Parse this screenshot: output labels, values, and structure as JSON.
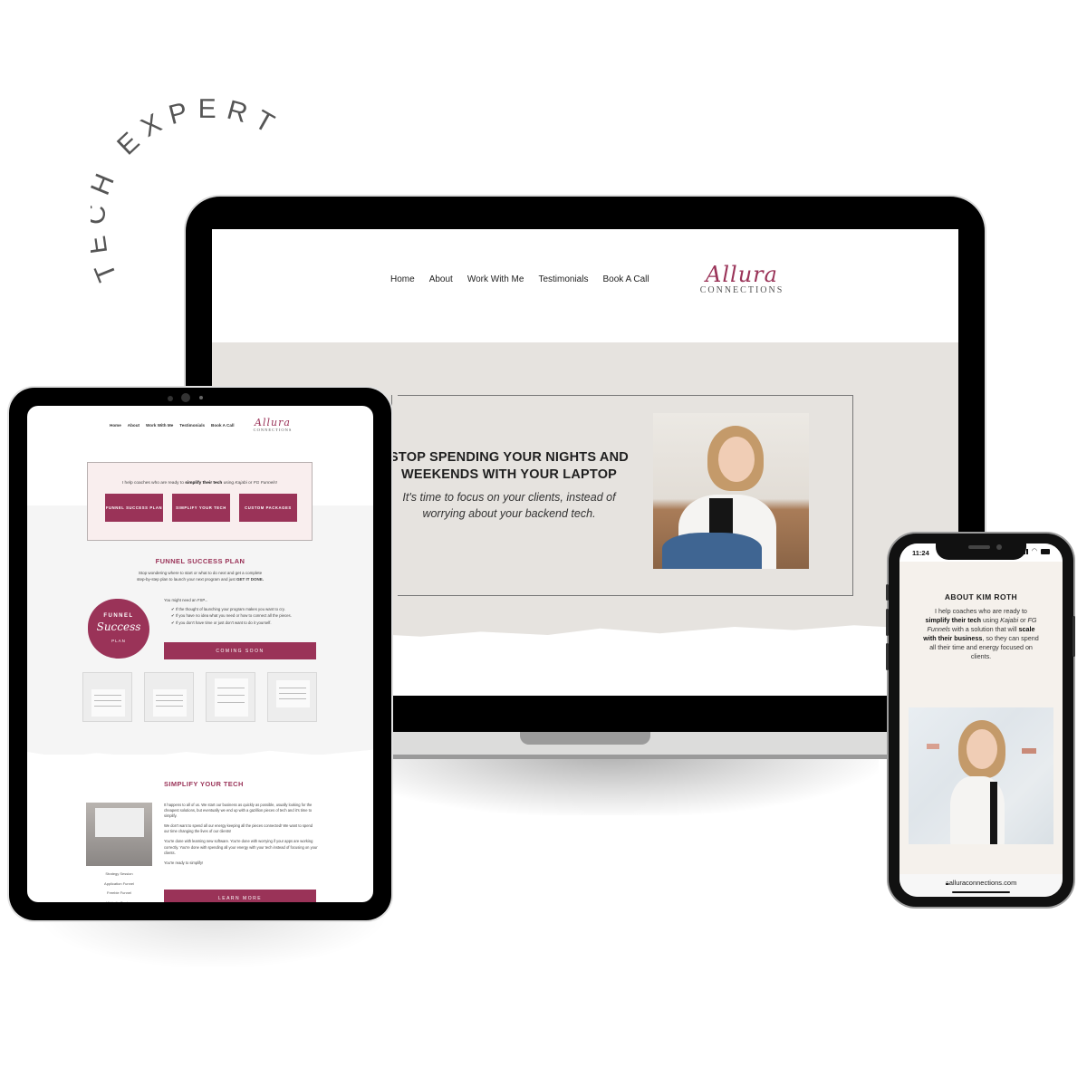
{
  "headline": {
    "arc_text": "TECH EXPERT"
  },
  "brand": {
    "logo_script": "Allura",
    "logo_caps": "CONNECTIONS",
    "accent_color": "#9a3358"
  },
  "laptop": {
    "nav": [
      "Home",
      "About",
      "Work With Me",
      "Testimonials",
      "Book A Call"
    ],
    "hero_title": "STOP SPENDING YOUR NIGHTS AND WEEKENDS WITH YOUR LAPTOP",
    "hero_subtitle": "It's time to focus on your clients, instead of worrying about your backend tech.",
    "hero_image": "portrait-photo"
  },
  "tablet": {
    "nav": [
      "Home",
      "About",
      "Work With Me",
      "Testimonials",
      "Book A Call"
    ],
    "intro_prefix": "I help coaches who are ready to ",
    "intro_bold": "simplify their tech",
    "intro_mid": " using ",
    "intro_kajabi": "Kajabi",
    "intro_or": " or ",
    "intro_fg": "FG Funnels!",
    "buttons": [
      "FUNNEL SUCCESS PLAN",
      "SIMPLIFY YOUR TECH",
      "CUSTOM PACKAGES"
    ],
    "fsp_title": "FUNNEL SUCCESS PLAN",
    "fsp_text_1": "Stop wondering where to start or what to do next and get a complete",
    "fsp_text_2": "step-by-step plan to launch your next program and just ",
    "fsp_text_bold": "GET IT DONE.",
    "badge_line1": "FUNNEL",
    "badge_line2": "Success",
    "badge_line3": "PLAN",
    "list_intro": "You might need an FSP...",
    "list_items": [
      "If the thought of launching your program makes you want to cry.",
      "If you have no idea what you need or how to connect all the pieces.",
      "If you don't have time or just don't want to do it yourself."
    ],
    "coming_soon": "COMING SOON",
    "simplify_title": "SIMPLIFY YOUR TECH",
    "simplify_paragraphs": [
      "It happens to all of us. We start our business as quickly as possible, usually looking for the cheapest solutions, but eventually we end up with a gazillion pieces of tech and it's time to simplify.",
      "We don't want to spend all our energy keeping all the pieces connected! We want to spend our time changing the lives of our clients!",
      "You're done with learning new software. You're done with worrying if your apps are working correctly. You're done with spending all your energy with your tech instead of focusing on your clients.",
      "You're ready to simplify!"
    ],
    "side_links": [
      "Strategy Session",
      "Application Funnel",
      "Freebie Funnel",
      "Website Design"
    ],
    "learn_more": "LEARN MORE"
  },
  "phone": {
    "time": "11:24",
    "about_title": "ABOUT KIM ROTH",
    "about_1": "I help coaches who are ready to ",
    "about_bold_1": "simplify their tech",
    "about_2": " using ",
    "about_kajabi": "Kajabi",
    "about_3": " or ",
    "about_fg": "FG Funnels",
    "about_4": " with a solution that will ",
    "about_bold_2": "scale with their business",
    "about_5": ", so they can spend all their time and energy focused on clients.",
    "url": "alluraconnections.com"
  }
}
